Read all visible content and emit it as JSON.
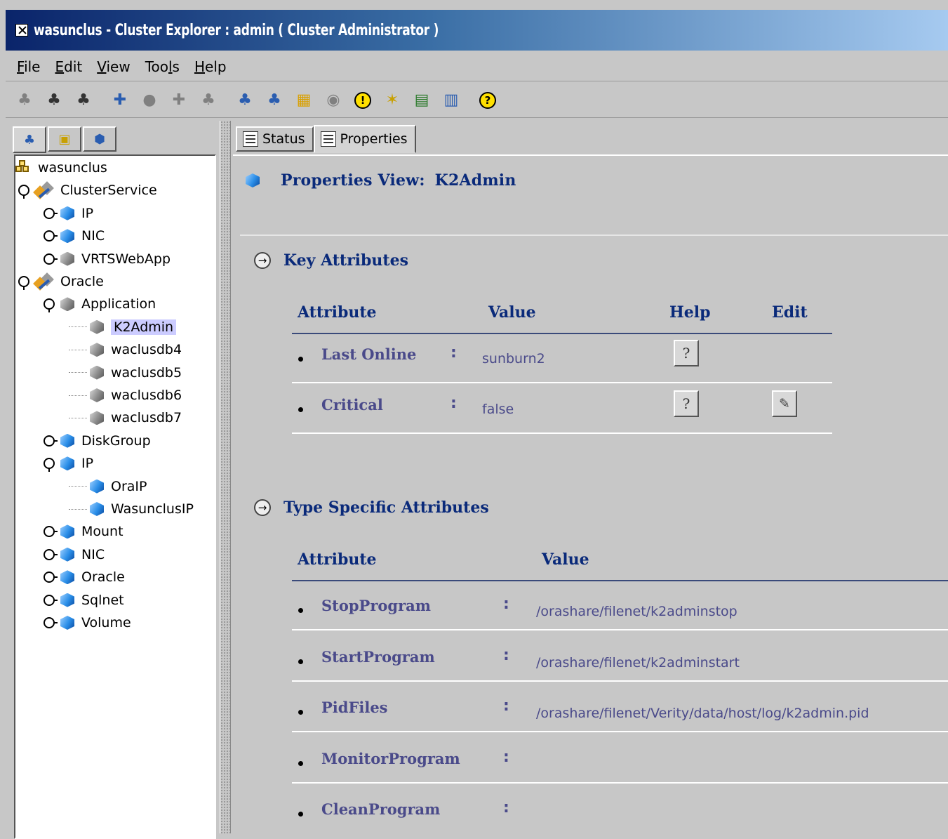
{
  "window": {
    "title": "wasunclus - Cluster Explorer : admin ( Cluster Administrator )"
  },
  "menu": {
    "items": [
      {
        "key": "F",
        "rest": "ile"
      },
      {
        "key": "E",
        "rest": "dit"
      },
      {
        "key": "V",
        "rest": "iew"
      },
      {
        "pre": "Too",
        "key": "l",
        "rest": "s"
      },
      {
        "key": "H",
        "rest": "elp"
      }
    ]
  },
  "toolbar": {
    "icons": [
      "add-service-group-icon",
      "online-group-icon",
      "offline-group-icon",
      "add-resource-icon",
      "resource-gray-icon",
      "add-resource-plus-icon",
      "disabled-resource-icon",
      "online-resource-icon",
      "offline-resource-icon",
      "cluster-matrix-icon",
      "disabled-circle-icon",
      "exclamation-alert-icon",
      "wizard-icon",
      "commands-icon",
      "log-icon",
      "help-icon"
    ]
  },
  "left_panel": {
    "tabs": [
      "service-groups-tab-icon",
      "systems-tab-icon",
      "resources-tab-icon"
    ],
    "tree": [
      {
        "label": "wasunclus",
        "level": 0,
        "icon": "cluster",
        "toggle": "none"
      },
      {
        "label": "ClusterService",
        "level": 0,
        "icon": "group",
        "toggle": "expanded"
      },
      {
        "label": "IP",
        "level": 1,
        "icon": "blue",
        "toggle": "collapsed"
      },
      {
        "label": "NIC",
        "level": 1,
        "icon": "blue",
        "toggle": "collapsed"
      },
      {
        "label": "VRTSWebApp",
        "level": 1,
        "icon": "grey",
        "toggle": "collapsed"
      },
      {
        "label": "Oracle",
        "level": 0,
        "icon": "group",
        "toggle": "expanded"
      },
      {
        "label": "Application",
        "level": 1,
        "icon": "grey",
        "toggle": "expanded"
      },
      {
        "label": "K2Admin",
        "level": 2,
        "icon": "grey",
        "toggle": "none",
        "selected": true
      },
      {
        "label": "waclusdb4",
        "level": 2,
        "icon": "grey",
        "toggle": "none"
      },
      {
        "label": "waclusdb5",
        "level": 2,
        "icon": "grey",
        "toggle": "none"
      },
      {
        "label": "waclusdb6",
        "level": 2,
        "icon": "grey",
        "toggle": "none"
      },
      {
        "label": "waclusdb7",
        "level": 2,
        "icon": "grey",
        "toggle": "none"
      },
      {
        "label": "DiskGroup",
        "level": 1,
        "icon": "blue",
        "toggle": "collapsed"
      },
      {
        "label": "IP",
        "level": 1,
        "icon": "blue",
        "toggle": "expanded"
      },
      {
        "label": "OraIP",
        "level": 2,
        "icon": "blue",
        "toggle": "none"
      },
      {
        "label": "WasunclusIP",
        "level": 2,
        "icon": "blue",
        "toggle": "none"
      },
      {
        "label": "Mount",
        "level": 1,
        "icon": "blue",
        "toggle": "collapsed"
      },
      {
        "label": "NIC",
        "level": 1,
        "icon": "blue",
        "toggle": "collapsed"
      },
      {
        "label": "Oracle",
        "level": 1,
        "icon": "blue",
        "toggle": "collapsed"
      },
      {
        "label": "Sqlnet",
        "level": 1,
        "icon": "blue",
        "toggle": "collapsed"
      },
      {
        "label": "Volume",
        "level": 1,
        "icon": "blue",
        "toggle": "collapsed"
      }
    ]
  },
  "right_panel": {
    "tabs": [
      {
        "label": "Status",
        "active": false
      },
      {
        "label": "Properties",
        "active": true
      }
    ],
    "header": {
      "label": "Properties View:",
      "resource": "K2Admin"
    },
    "key_attributes": {
      "title": "Key Attributes",
      "columns": [
        "Attribute",
        "Value",
        "Help",
        "Edit"
      ],
      "rows": [
        {
          "name": "Last Online",
          "value": "sunburn2",
          "help": true,
          "edit": false
        },
        {
          "name": "Critical",
          "value": "false",
          "help": true,
          "edit": true
        }
      ]
    },
    "type_specific": {
      "title": "Type Specific Attributes",
      "columns": [
        "Attribute",
        "Value"
      ],
      "rows": [
        {
          "name": "StopProgram",
          "value": "/orashare/filenet/k2adminstop"
        },
        {
          "name": "StartProgram",
          "value": "/orashare/filenet/k2adminstart"
        },
        {
          "name": "PidFiles",
          "value": "/orashare/filenet/Verity/data/host/log/k2admin.pid"
        },
        {
          "name": "MonitorProgram",
          "value": ""
        },
        {
          "name": "CleanProgram",
          "value": ""
        }
      ]
    },
    "separator": ":"
  },
  "colors": {
    "title_gradient_start": "#0a246a",
    "heading": "#0a2a7a",
    "attribute_text": "#4a4a8a",
    "selection": "#ccccff",
    "background": "#c7c7c7"
  }
}
